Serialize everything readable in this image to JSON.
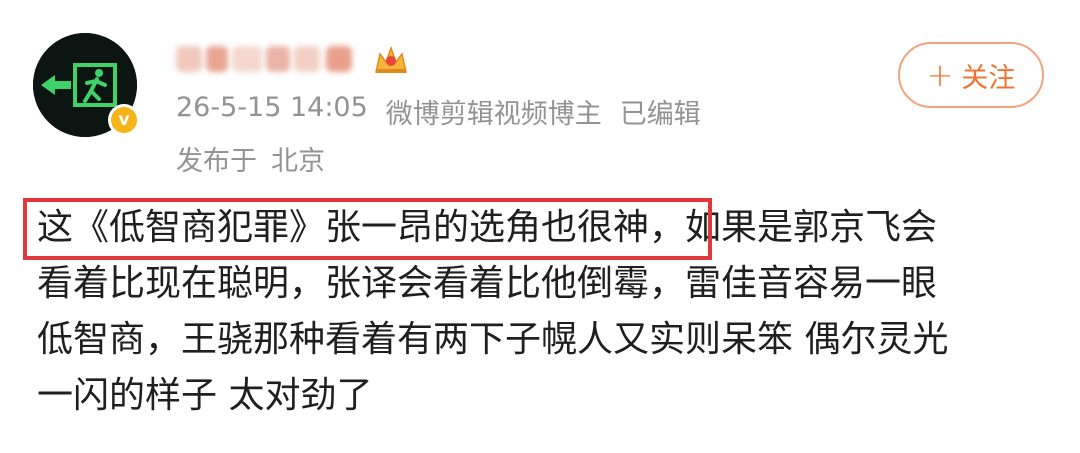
{
  "post": {
    "author": {
      "avatar_icon": "emergency-exit-icon",
      "avatar_colors": {
        "background": "#0d1512",
        "sign": "#3fd16a"
      },
      "verified_badge": {
        "label": "v",
        "color": "#f5b417"
      },
      "member_badge_icon": "crown-icon"
    },
    "meta": {
      "timestamp": "26-5-15 14:05",
      "author_title": "微博剪辑视频博主",
      "edited": "已编辑"
    },
    "location": {
      "prefix": "发布于",
      "city": "北京"
    },
    "follow_button": {
      "plus": "+",
      "label": "关注",
      "color": "#f07431"
    },
    "body_lines": [
      {
        "highlighted": "这《低智商犯罪》张一昂的选角也很神",
        "rest": "，如果是郭京飞会"
      },
      {
        "text": "看着比现在聪明，张译会看着比他倒霉，雷佳音容易一眼"
      },
      {
        "text": "低智商，王骁那种看着有两下子幌人又实则呆笨 偶尔灵光"
      },
      {
        "text": "一闪的样子 太对劲了"
      }
    ],
    "highlight_color": "#e2373d"
  }
}
